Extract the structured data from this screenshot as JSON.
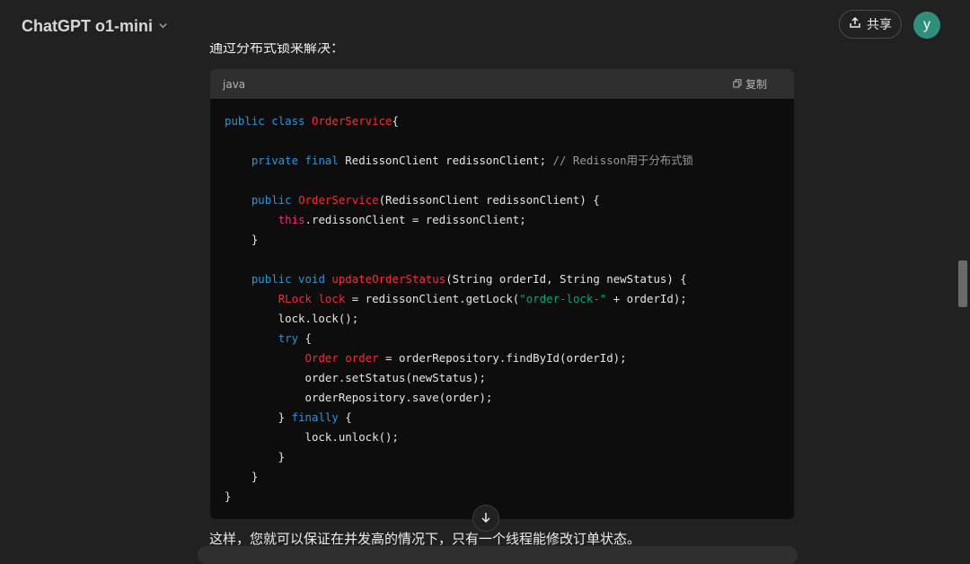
{
  "header": {
    "model_name": "ChatGPT o1-mini",
    "share_label": "共享",
    "avatar_letter": "y"
  },
  "message": {
    "intro_text": "通过分布式锁来解决：",
    "outro_text": "这样，您就可以保证在并发高的情况下，只有一个线程能修改订单状态。"
  },
  "code_block": {
    "language": "java",
    "copy_label": "复制",
    "lines": [
      [
        [
          "kw",
          "public class "
        ],
        [
          "ty",
          "OrderService"
        ],
        [
          "",
          "{"
        ]
      ],
      [],
      [
        [
          "",
          "    "
        ],
        [
          "kw",
          "private final "
        ],
        [
          "",
          "RedissonClient redissonClient; "
        ],
        [
          "cm",
          "// Redisson用于分布式锁"
        ]
      ],
      [],
      [
        [
          "",
          "    "
        ],
        [
          "kw",
          "public "
        ],
        [
          "fn",
          "OrderService"
        ],
        [
          "",
          "(RedissonClient redissonClient) {"
        ]
      ],
      [
        [
          "",
          "        "
        ],
        [
          "th",
          "this"
        ],
        [
          "",
          ".redissonClient = redissonClient;"
        ]
      ],
      [
        [
          "",
          "    }"
        ]
      ],
      [],
      [
        [
          "",
          "    "
        ],
        [
          "kw",
          "public void "
        ],
        [
          "fn",
          "updateOrderStatus"
        ],
        [
          "",
          "(String orderId, String newStatus) {"
        ]
      ],
      [
        [
          "",
          "        "
        ],
        [
          "ty",
          "RLock lock"
        ],
        [
          "",
          " = redissonClient.getLock("
        ],
        [
          "st",
          "\"order-lock-\""
        ],
        [
          "",
          " + orderId);"
        ]
      ],
      [
        [
          "",
          "        lock.lock();"
        ]
      ],
      [
        [
          "",
          "        "
        ],
        [
          "kw",
          "try "
        ],
        [
          "",
          "{"
        ]
      ],
      [
        [
          "",
          "            "
        ],
        [
          "ty",
          "Order order"
        ],
        [
          "",
          " = orderRepository.findById(orderId);"
        ]
      ],
      [
        [
          "",
          "            order.setStatus(newStatus);"
        ]
      ],
      [
        [
          "",
          "            orderRepository.save(order);"
        ]
      ],
      [
        [
          "",
          "        } "
        ],
        [
          "kw",
          "finally "
        ],
        [
          "",
          "{"
        ]
      ],
      [
        [
          "",
          "            lock.unlock();"
        ]
      ],
      [
        [
          "",
          "        }"
        ]
      ],
      [
        [
          "",
          "    }"
        ]
      ],
      [
        [
          "",
          "}"
        ]
      ]
    ]
  },
  "colors": {
    "background": "#212121",
    "code_bg": "#0d0d0d",
    "code_header_bg": "#2f2f2f",
    "keyword": "#2e95d3",
    "type": "#f22c3d",
    "comment": "#999999",
    "string": "#00a67d",
    "this": "#df3079",
    "avatar": "#2f8f7a"
  },
  "icons": {
    "share": "share-upload-icon",
    "copy": "copy-icon",
    "chevron": "chevron-down-icon",
    "scroll_down": "arrow-down-icon"
  }
}
